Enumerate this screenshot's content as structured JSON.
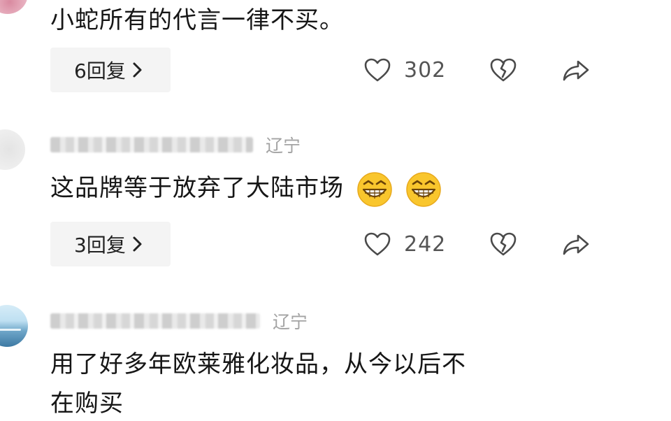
{
  "comments": [
    {
      "text": "小蛇所有的代言一律不买。",
      "reply_label": "6回复",
      "like_count": "302"
    },
    {
      "username": "想度鸟的咪了 2 1",
      "location": "辽宁",
      "text": "这品牌等于放弃了大陆市场",
      "emoji_count": 2,
      "reply_label": "3回复",
      "like_count": "242"
    },
    {
      "username": "旷门百江",
      "location": "辽宁",
      "text_line1": "用了好多年欧莱雅化妆品，从今以后不",
      "text_line2": "在购买"
    }
  ],
  "icons": {
    "like": "heart-outline-icon",
    "dislike": "broken-heart-icon",
    "share": "share-arrow-icon",
    "reply_arrow": "chevron-right-icon",
    "emoji": "grinning-face-emoji"
  },
  "colors": {
    "text": "#161616",
    "meta": "#9a9a9a",
    "icon": "#4a4a4a",
    "pill_bg": "#f4f4f4",
    "emoji_face": "#f9c62d"
  }
}
